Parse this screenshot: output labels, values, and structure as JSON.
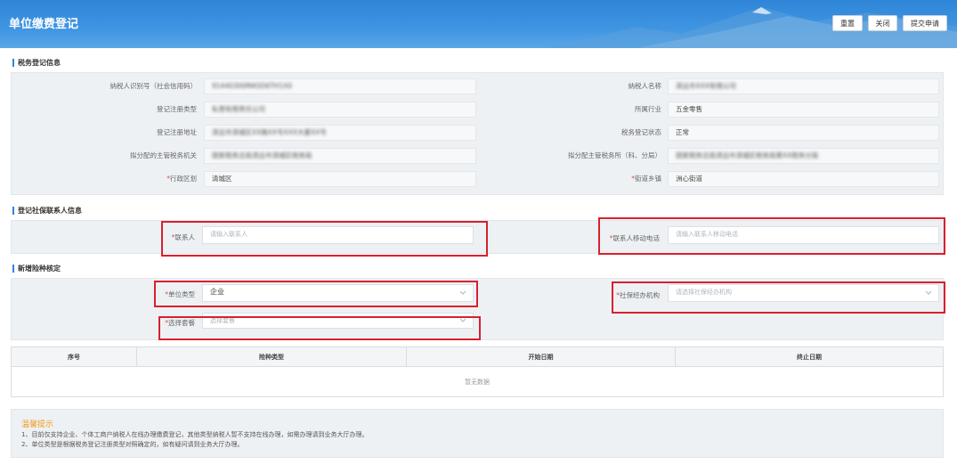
{
  "header": {
    "title": "单位缴费登记",
    "buttons": {
      "reset": "重置",
      "close": "关闭",
      "submit": "提交申请"
    }
  },
  "tax_info": {
    "section_title": "税务登记信息",
    "fields": [
      {
        "label": "纳税人识别号（社会信用码）",
        "value": "91440300MA5D6TH1X0"
      },
      {
        "label": "纳税人名称",
        "value": "清远市XXX有限公司"
      },
      {
        "label": "登记注册类型",
        "value": "私营有限责任公司"
      },
      {
        "label": "所属行业",
        "value": "五金零售"
      },
      {
        "label": "登记注册地址",
        "value": "清远市清城区XX路XX号XXX大厦XX号"
      },
      {
        "label": "税务登记状态",
        "value": "正常"
      },
      {
        "label": "拟分配的主管税务机关",
        "value": "国家税务总局清远市清城区税务局"
      },
      {
        "label": "拟分配主管税务所（科、分局）",
        "value": "国家税务总局清远市清城区税务局第XX税务分局"
      },
      {
        "label": "行政区划",
        "value": "清城区",
        "required": "*"
      },
      {
        "label": "街道乡镇",
        "value": "洲心街道",
        "required": "*"
      }
    ]
  },
  "contact_info": {
    "section_title": "登记社保联系人信息",
    "contact_label": "联系人",
    "contact_placeholder": "请输入联系人",
    "phone_label": "联系人移动电话",
    "phone_placeholder": "请输入联系人移动电话",
    "required": "*"
  },
  "insurance": {
    "section_title": "新增险种核定",
    "unit_type_label": "单位类型",
    "unit_type_value": "企业",
    "agency_label": "社保经办机构",
    "agency_placeholder": "请选择社保经办机构",
    "package_label": "选择套餐",
    "package_placeholder": "选择套餐",
    "required": "*"
  },
  "table": {
    "columns": [
      "序号",
      "险种类型",
      "开始日期",
      "终止日期"
    ],
    "empty_text": "暂无数据"
  },
  "tips": {
    "title": "温馨提示",
    "lines": [
      "1、目前仅支持企业、个体工商户纳税人在线办理缴费登记，其他类型纳税人暂不支持在线办理，如需办理请到业务大厅办理。",
      "2、单位类型是根据税务登记注册类型对照确定的，如有疑问请到业务大厅办理。"
    ]
  },
  "colors": {
    "header": "#2f86d8",
    "highlight": "#d8202f",
    "required": "#e64a4a",
    "tip_title": "#f39a1e"
  }
}
